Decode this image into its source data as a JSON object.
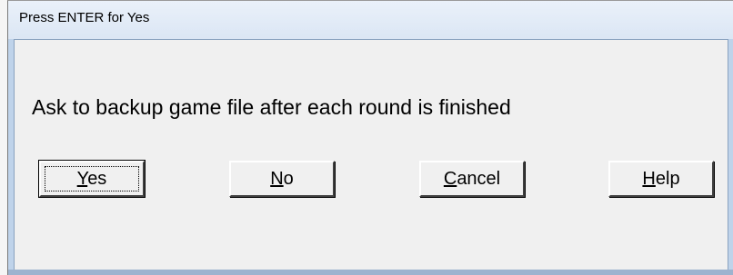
{
  "window": {
    "title": "Press ENTER for Yes"
  },
  "dialog": {
    "message": "Ask to backup game file after each round is finished"
  },
  "buttons": {
    "yes": {
      "access_key": "Y",
      "rest": "es"
    },
    "no": {
      "access_key": "N",
      "rest": "o"
    },
    "cancel": {
      "access_key": "C",
      "rest": "ancel"
    },
    "help": {
      "access_key": "H",
      "rest": "elp"
    }
  }
}
